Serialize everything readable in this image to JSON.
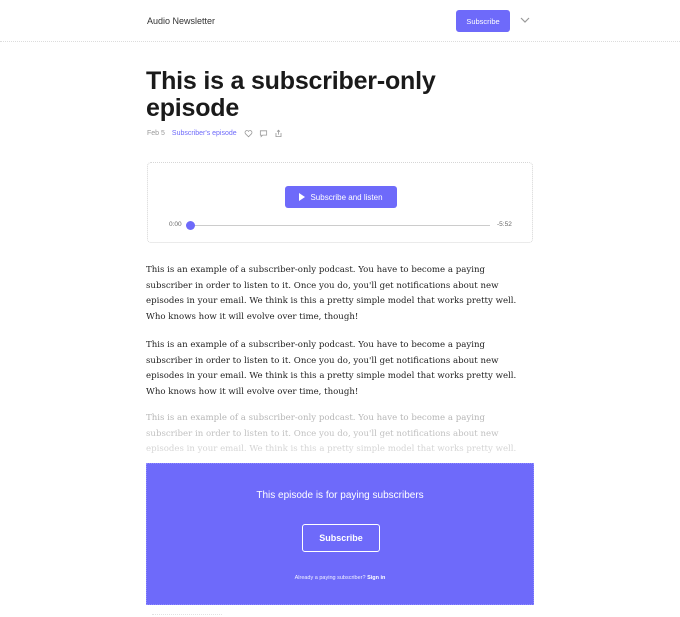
{
  "header": {
    "publication": "Audio Newsletter",
    "subscribe_label": "Subscribe",
    "menu_icon": "chevron-down-icon"
  },
  "post": {
    "title": "This is a subscriber-only episode",
    "date": "Feb 5",
    "episode_type": "Subscriber's episode",
    "action_icons": [
      "heart-icon",
      "comment-icon",
      "share-icon"
    ]
  },
  "player": {
    "button_label": "Subscribe and listen",
    "time_elapsed": "0:00",
    "time_remaining": "-5:52",
    "progress": 0
  },
  "body": {
    "paragraphs": [
      "This is an example of a subscriber-only podcast. You have to become a paying subscriber in order to listen to it. Once you do, you'll get notifications about new episodes in your email. We think is this a pretty simple model that works pretty well. Who knows how it will evolve over time, though!",
      "This is an example of a subscriber-only podcast. You have to become a paying subscriber in order to listen to it. Once you do, you'll get notifications about new episodes in your email. We think is this a pretty simple model that works pretty well. Who knows how it will evolve over time, though!",
      "This is an example of a subscriber-only podcast. You have to become a paying subscriber in order to listen to it. Once you do, you'll get notifications about new episodes in your email. We think is this a pretty simple model that works pretty well."
    ]
  },
  "paywall": {
    "title": "This episode is for paying subscribers",
    "subscribe_label": "Subscribe",
    "signin_prompt": "Already a paying subscriber?",
    "signin_label": "Sign in"
  },
  "colors": {
    "accent": "#6e6afa"
  }
}
